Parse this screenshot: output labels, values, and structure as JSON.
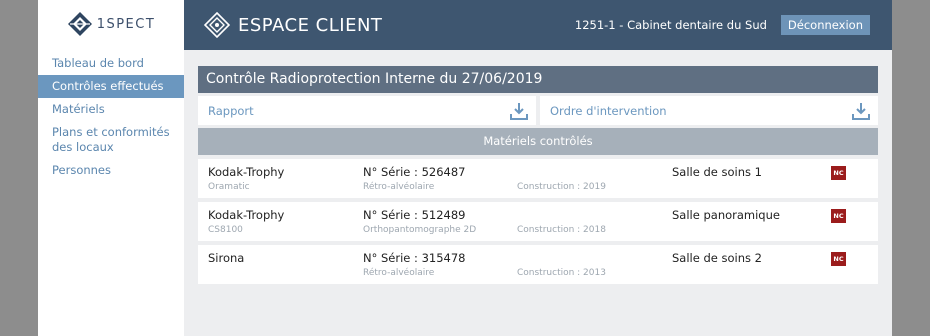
{
  "sidebar": {
    "logo_text": "1SPECT",
    "items": [
      {
        "label": "Tableau de bord"
      },
      {
        "label": "Contrôles effectués"
      },
      {
        "label": "Matériels"
      },
      {
        "label": "Plans et conformités des locaux"
      },
      {
        "label": "Personnes"
      }
    ],
    "active_index": 1
  },
  "header": {
    "title": "ESPACE CLIENT",
    "client": "1251-1 - Cabinet dentaire du Sud",
    "logout_label": "Déconnexion"
  },
  "control": {
    "title": "Contrôle Radioprotection Interne du 27/06/2019",
    "documents": [
      {
        "label": "Rapport"
      },
      {
        "label": "Ordre d'intervention"
      }
    ]
  },
  "equipment": {
    "section_title": "Matériels contrôlés",
    "rows": [
      {
        "name": "Kodak-Trophy",
        "model": "Oramatic",
        "serial": "N° Série : 526487",
        "type": "Rétro-alvéolaire",
        "construction": "Construction : 2019",
        "room": "Salle de soins 1",
        "badge": "NC"
      },
      {
        "name": "Kodak-Trophy",
        "model": "CS8100",
        "serial": "N° Série : 512489",
        "type": "Orthopantomographe 2D",
        "construction": "Construction : 2018",
        "room": "Salle panoramique",
        "badge": "NC"
      },
      {
        "name": "Sirona",
        "model": "",
        "serial": "N° Série : 315478",
        "type": "Rétro-alvéolaire",
        "construction": "Construction : 2013",
        "room": "Salle de soins 2",
        "badge": "NC"
      }
    ]
  },
  "colors": {
    "header_bg": "#3e5670",
    "accent": "#6b97bf",
    "nc_badge": "#9b1c1c"
  },
  "icons": {
    "logo": "diamond-logo-icon",
    "download": "download-icon"
  }
}
